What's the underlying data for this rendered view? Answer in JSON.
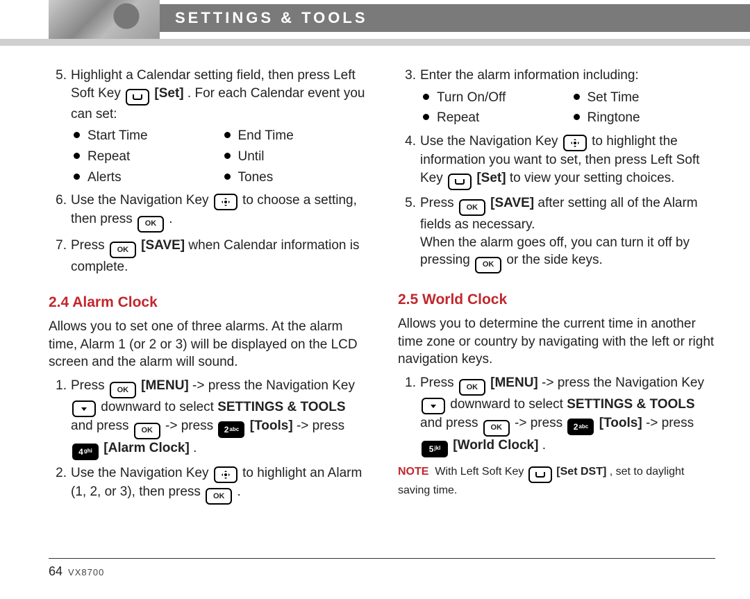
{
  "header": {
    "title": "SETTINGS & TOOLS"
  },
  "left": {
    "step5a": "Highlight a Calendar setting field, then press Left Soft Key ",
    "step5_set": "[Set]",
    "step5b": " . For each Calendar event you can set:",
    "step5_items": [
      "Start Time",
      "End Time",
      "Repeat",
      "Until",
      "Alerts",
      "Tones"
    ],
    "step6a": "Use the Navigation Key ",
    "step6b": " to choose a setting, then press ",
    "step7a": "Press ",
    "step7_save": "[SAVE]",
    "step7b": " when Calendar information is complete.",
    "h1": "2.4 Alarm Clock",
    "intro": "Allows you to set one of three alarms. At the alarm time, Alarm 1 (or 2 or 3) will be displayed on the LCD screen and the alarm will sound.",
    "a1a": "Press ",
    "a1_menu": "[MENU]",
    "a1b": " -> press the Navigation Key ",
    "a1c": " downward to select ",
    "a1_st": "SETTINGS & TOOLS",
    "a1d": " and press ",
    "a1e": " -> press ",
    "a1_tools": "[Tools]",
    "a1f": " -> press ",
    "a1_ac": "[Alarm Clock]",
    "a2a": "Use the Navigation Key ",
    "a2b": " to highlight an Alarm (1, 2, or 3), then press "
  },
  "right": {
    "step3a": "Enter the alarm information including:",
    "step3_items": [
      "Turn On/Off",
      "Set Time",
      "Repeat",
      "Ringtone"
    ],
    "step4a": "Use the Navigation Key ",
    "step4b": " to highlight the information you want to set, then press Left Soft Key ",
    "step4_set": "[Set]",
    "step4c": " to view your setting choices.",
    "step5a": "Press ",
    "step5_save": "[SAVE]",
    "step5b": " after setting all of the Alarm fields as necessary.",
    "step5extra1": "When the alarm goes off, you can turn it off by pressing ",
    "step5extra2": " or the side keys.",
    "h1": "2.5 World Clock",
    "intro": "Allows you to determine the current time in another time zone or country by navigating with the left or right navigation keys.",
    "w1a": "Press ",
    "w1_menu": "[MENU]",
    "w1b": " -> press the Navigation Key ",
    "w1c": " downward to select ",
    "w1_st": "SETTINGS & TOOLS",
    "w1d": " and press ",
    "w1e": " -> press ",
    "w1_tools": "[Tools]",
    "w1f": " -> press ",
    "w1_wc": "[World Clock]",
    "note_label": "NOTE",
    "note_a": "With Left Soft Key ",
    "note_setdst": "[Set DST]",
    "note_b": " , set to daylight saving time."
  },
  "footer": {
    "page": "64",
    "model": "VX8700"
  },
  "icons": {
    "ok": "OK"
  },
  "keys": {
    "k2abc_maj": "2",
    "k2abc_sub": "abc",
    "k4ghi_maj": "4",
    "k4ghi_sub": "ghi",
    "k5jkl_maj": "5",
    "k5jkl_sub": "jkl"
  }
}
